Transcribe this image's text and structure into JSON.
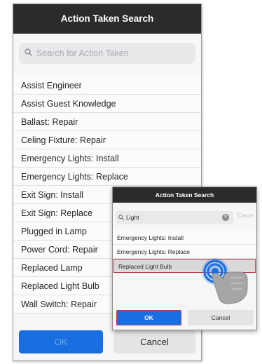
{
  "main": {
    "title": "Action Taken Search",
    "search": {
      "placeholder": "Search for Action Taken",
      "icon": "search-icon"
    },
    "items": [
      "Assist Engineer",
      "Assist Guest Knowledge",
      "Ballast: Repair",
      "Celing Fixture: Repair",
      "Emergency Lights: Install",
      "Emergency Lights: Replace",
      "Exit Sign: Install",
      "Exit Sign: Replace",
      "Plugged in Lamp",
      "Power Cord: Repair",
      "Replaced Lamp",
      "Replaced Light Bulb",
      "Wall Switch: Repair"
    ],
    "ok_label": "OK",
    "cancel_label": "Cancel"
  },
  "popup": {
    "title": "Action Taken Search",
    "search": {
      "value": "Light",
      "clear_icon": "clear-icon",
      "cancel_label": "Cance"
    },
    "items": [
      "Emergency Lights: Install",
      "Emergency Lights: Replace",
      "Replaced Light Bulb"
    ],
    "selected_index": 2,
    "ok_label": "OK",
    "cancel_label": "Cancel"
  },
  "colors": {
    "header_bg": "#2b2b2b",
    "primary_blue": "#1a6fe0",
    "highlight_border": "#b23a4a",
    "tap_ring": "#1a6fe0"
  },
  "gesture": {
    "icon": "hand-tap-icon"
  }
}
